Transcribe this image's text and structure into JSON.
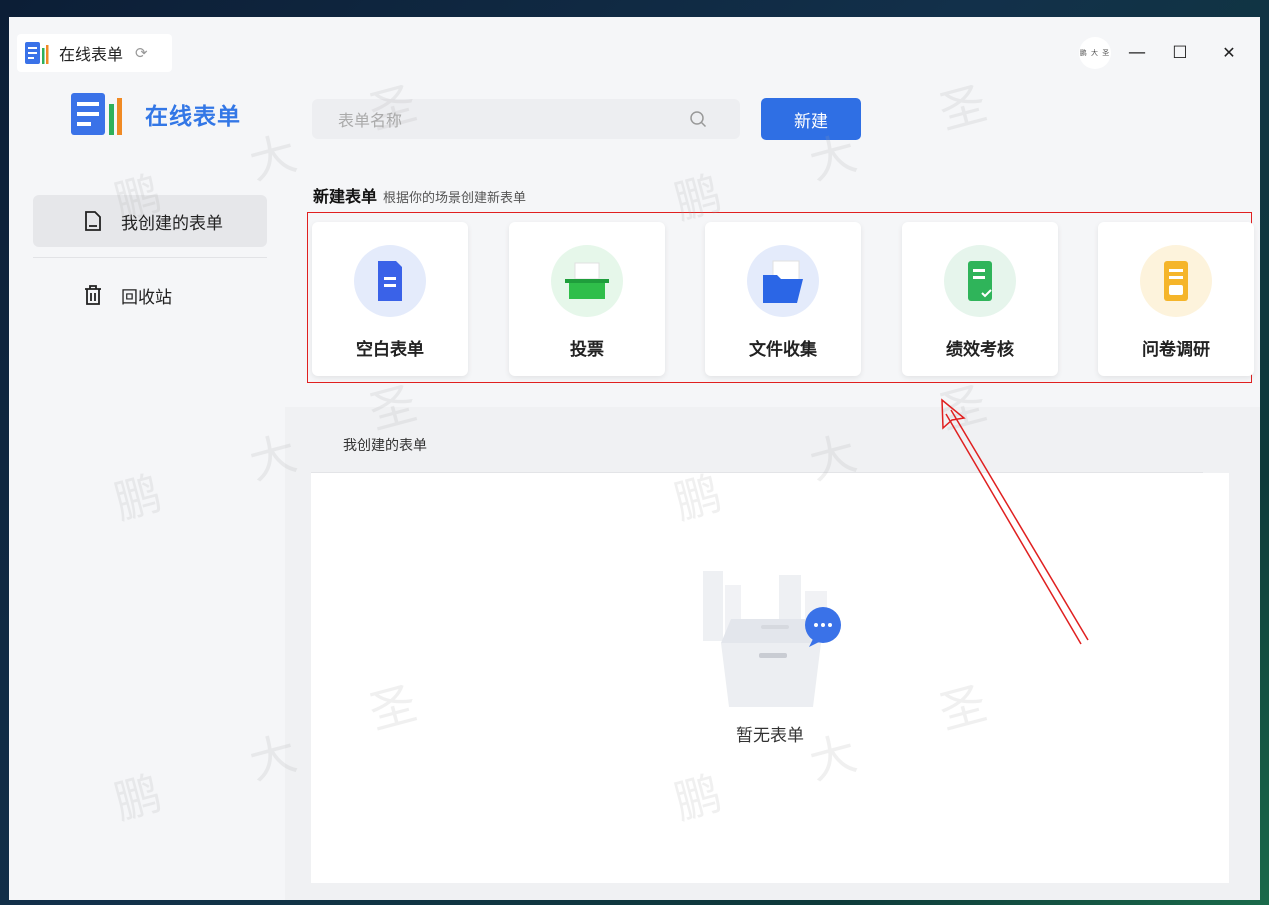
{
  "titlebar": {
    "title": "在线表单",
    "refresh_icon": "refresh-icon",
    "avatar_text": "鹏 大 圣",
    "minimize": "—",
    "maximize": "☐",
    "close": "✕"
  },
  "sidebar": {
    "brand": "在线表单",
    "items": [
      {
        "label": "我创建的表单",
        "icon": "document-icon",
        "active": true
      },
      {
        "label": "回收站",
        "icon": "trash-icon",
        "active": false
      }
    ]
  },
  "toolbar": {
    "search_placeholder": "表单名称",
    "new_button": "新建"
  },
  "templates": {
    "title": "新建表单",
    "subtitle": "根据你的场景创建新表单",
    "items": [
      {
        "label": "空白表单",
        "icon": "blank-form-icon",
        "color": "#3a62e8"
      },
      {
        "label": "投票",
        "icon": "vote-box-icon",
        "color": "#2fbe4a"
      },
      {
        "label": "文件收集",
        "icon": "folder-icon",
        "color": "#2b66e6"
      },
      {
        "label": "绩效考核",
        "icon": "checklist-icon",
        "color": "#2fb45a"
      },
      {
        "label": "问卷调研",
        "icon": "survey-icon",
        "color": "#f5b52a"
      }
    ]
  },
  "my_forms": {
    "title": "我创建的表单",
    "empty_text": "暂无表单"
  },
  "watermark": [
    "鹏",
    "大",
    "圣"
  ],
  "colors": {
    "accent": "#2f6fe4",
    "brand": "#3377e6",
    "annotation": "#e02020"
  }
}
